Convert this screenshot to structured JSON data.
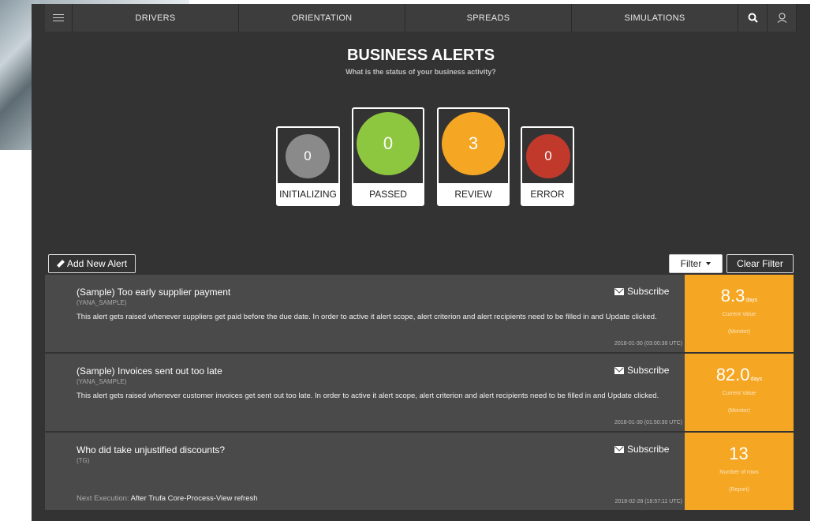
{
  "nav": {
    "tabs": [
      "DRIVERS",
      "ORIENTATION",
      "SPREADS",
      "SIMULATIONS"
    ],
    "icons": [
      "menu-icon",
      "search-icon",
      "user-icon"
    ]
  },
  "header": {
    "title": "BUSINESS ALERTS",
    "subtitle": "What is the status of your business activity?"
  },
  "status": [
    {
      "label": "INITIALIZING",
      "count": "0",
      "color": "#8a8a8a"
    },
    {
      "label": "PASSED",
      "count": "0",
      "color": "#8dc63f"
    },
    {
      "label": "REVIEW",
      "count": "3",
      "color": "#f5a623"
    },
    {
      "label": "ERROR",
      "count": "0",
      "color": "#c0392b"
    }
  ],
  "toolbar": {
    "add_label": "Add New Alert",
    "filter_label": "Filter",
    "clear_label": "Clear Filter"
  },
  "alerts": [
    {
      "title": "(Sample) Too early supplier payment",
      "id": "(YANA_SAMPLE)",
      "description": "This alert gets raised whenever suppliers get paid before the due date. In order to active it alert scope, alert criterion and alert recipients need to be filled in and Update clicked.",
      "subscribe": "Subscribe",
      "timestamp": "2018-01-30 (03:00:38 UTC)",
      "metric_value": "8.3",
      "metric_unit": "days",
      "metric_label": "Current Value",
      "metric_kind": "(Monitor)"
    },
    {
      "title": "(Sample) Invoices sent out too late",
      "id": "(YANA_SAMPLE)",
      "description": "This alert gets raised whenever customer invoices get sent out too late. In order to active it alert scope, alert criterion and alert recipients need to be filled in and Update clicked.",
      "subscribe": "Subscribe",
      "timestamp": "2018-01-30 (01:50:30 UTC)",
      "metric_value": "82.0",
      "metric_unit": "days",
      "metric_label": "Current Value",
      "metric_kind": "(Monitor)"
    },
    {
      "title": "Who did take unjustified discounts?",
      "id": "(TG)",
      "next_label": "Next Execution:",
      "next_value": "After Trufa Core-Process-View refresh",
      "subscribe": "Subscribe",
      "timestamp": "2018-02-28 (18:57:11 UTC)",
      "metric_value": "13",
      "metric_unit": "",
      "metric_label": "Number of rows",
      "metric_kind": "(Report)"
    }
  ]
}
